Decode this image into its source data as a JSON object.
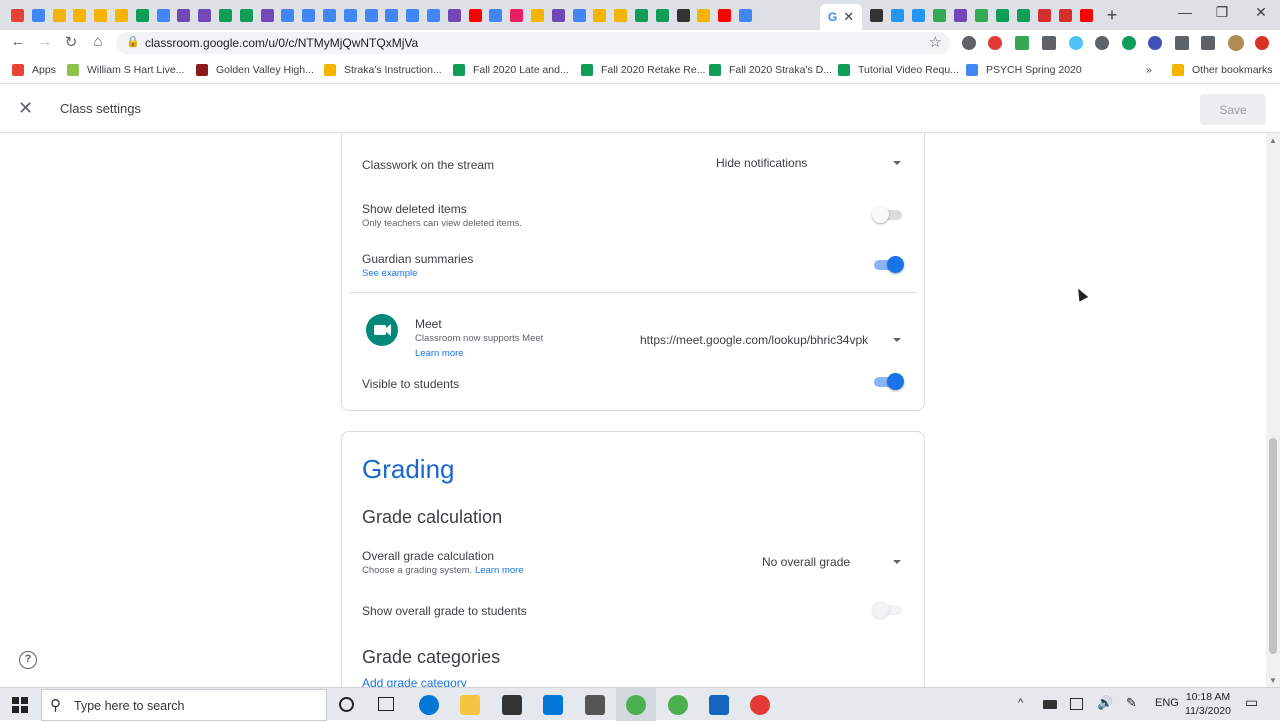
{
  "browser": {
    "tab_favicon_colors": [
      "#ea4335",
      "#4285f4",
      "#f4b400",
      "#f4b400",
      "#f4b400",
      "#f4b400",
      "#0f9d58",
      "#4285f4",
      "#7248b9",
      "#7248b9",
      "#0f9d58",
      "#0f9d58",
      "#7248b9",
      "#4285f4",
      "#4285f4",
      "#4285f4",
      "#4285f4",
      "#4285f4",
      "#4285f4",
      "#4285f4",
      "#4285f4",
      "#7248b9",
      "#ff0000",
      "#4285f4",
      "#e91e63",
      "#f4b400",
      "#7248b9",
      "#4285f4",
      "#f4b400",
      "#f4b400",
      "#0f9d58",
      "#0f9d58",
      "#333333",
      "#f4b400",
      "#ff0000",
      "#4285f4"
    ],
    "active_tab_icon": "google-icon",
    "right_tab_favicon_colors": [
      "#333333",
      "#2196f3",
      "#2196f3",
      "#34a853",
      "#7248b9",
      "#34a853",
      "#0f9d58",
      "#0f9d58",
      "#d32f2f",
      "#d32f2f",
      "#ff0000"
    ],
    "new_tab_symbol": "+",
    "close_tab_symbol": "✕",
    "window_controls": {
      "minimize": "—",
      "restore": "❐",
      "close": "✕"
    },
    "url": "classroom.google.com/u/0/c/NTMyMjQwNTQxMjVa",
    "nav_icons": {
      "back": "←",
      "forward": "→",
      "reload": "↻",
      "home": "⌂"
    },
    "bookmarks": [
      {
        "label": "Apps",
        "color": "#ea4335"
      },
      {
        "label": "William S Hart Live...",
        "color": "#8bc34a"
      },
      {
        "label": "Golden Valley High...",
        "color": "#8b1a1a"
      },
      {
        "label": "Straka's Instruction...",
        "color": "#f4b400"
      },
      {
        "label": "Fall 2020 Late and...",
        "color": "#0f9d58"
      },
      {
        "label": "Fall 2020 Retake Re...",
        "color": "#0f9d58"
      },
      {
        "label": "Fall 2020 Straka's D...",
        "color": "#0f9d58"
      },
      {
        "label": "Tutorial Video Requ...",
        "color": "#0f9d58"
      },
      {
        "label": "PSYCH Spring 2020",
        "color": "#4285f4"
      }
    ],
    "bookmarks_overflow": "»",
    "other_bookmarks": "Other bookmarks"
  },
  "app": {
    "close_symbol": "✕",
    "title": "Class settings",
    "save_label": "Save"
  },
  "settings": {
    "classwork_stream": {
      "label": "Classwork on the stream",
      "value": "Hide notifications"
    },
    "show_deleted": {
      "label": "Show deleted items",
      "sub": "Only teachers can view deleted items.",
      "on": false
    },
    "guardian": {
      "label": "Guardian summaries",
      "link": "See example",
      "on": true
    },
    "meet": {
      "label": "Meet",
      "sub": "Classroom now supports Meet",
      "link": "Learn more",
      "value": "https://meet.google.com/lookup/bhric34vpk"
    },
    "visible_students": {
      "label": "Visible to students",
      "on": true
    }
  },
  "grading": {
    "heading": "Grading",
    "calc_heading": "Grade calculation",
    "overall_calc": {
      "label": "Overall grade calculation",
      "sub": "Choose a grading system.",
      "link": "Learn more",
      "value": "No overall grade"
    },
    "show_overall": {
      "label": "Show overall grade to students",
      "on": false
    },
    "categories_heading": "Grade categories",
    "add_category": "Add grade category"
  },
  "colors": {
    "accent": "#1a73e8",
    "toggle_on_track": "#8ab4f8",
    "toggle_off_track": "#dadce0",
    "meet_green": "#00897b"
  },
  "help_symbol": "?",
  "taskbar": {
    "search_placeholder": "Type here to search",
    "lang": "ENG",
    "time": "10:18 AM",
    "date": "11/3/2020",
    "tray_up": "^",
    "notification_icon": "▭"
  }
}
